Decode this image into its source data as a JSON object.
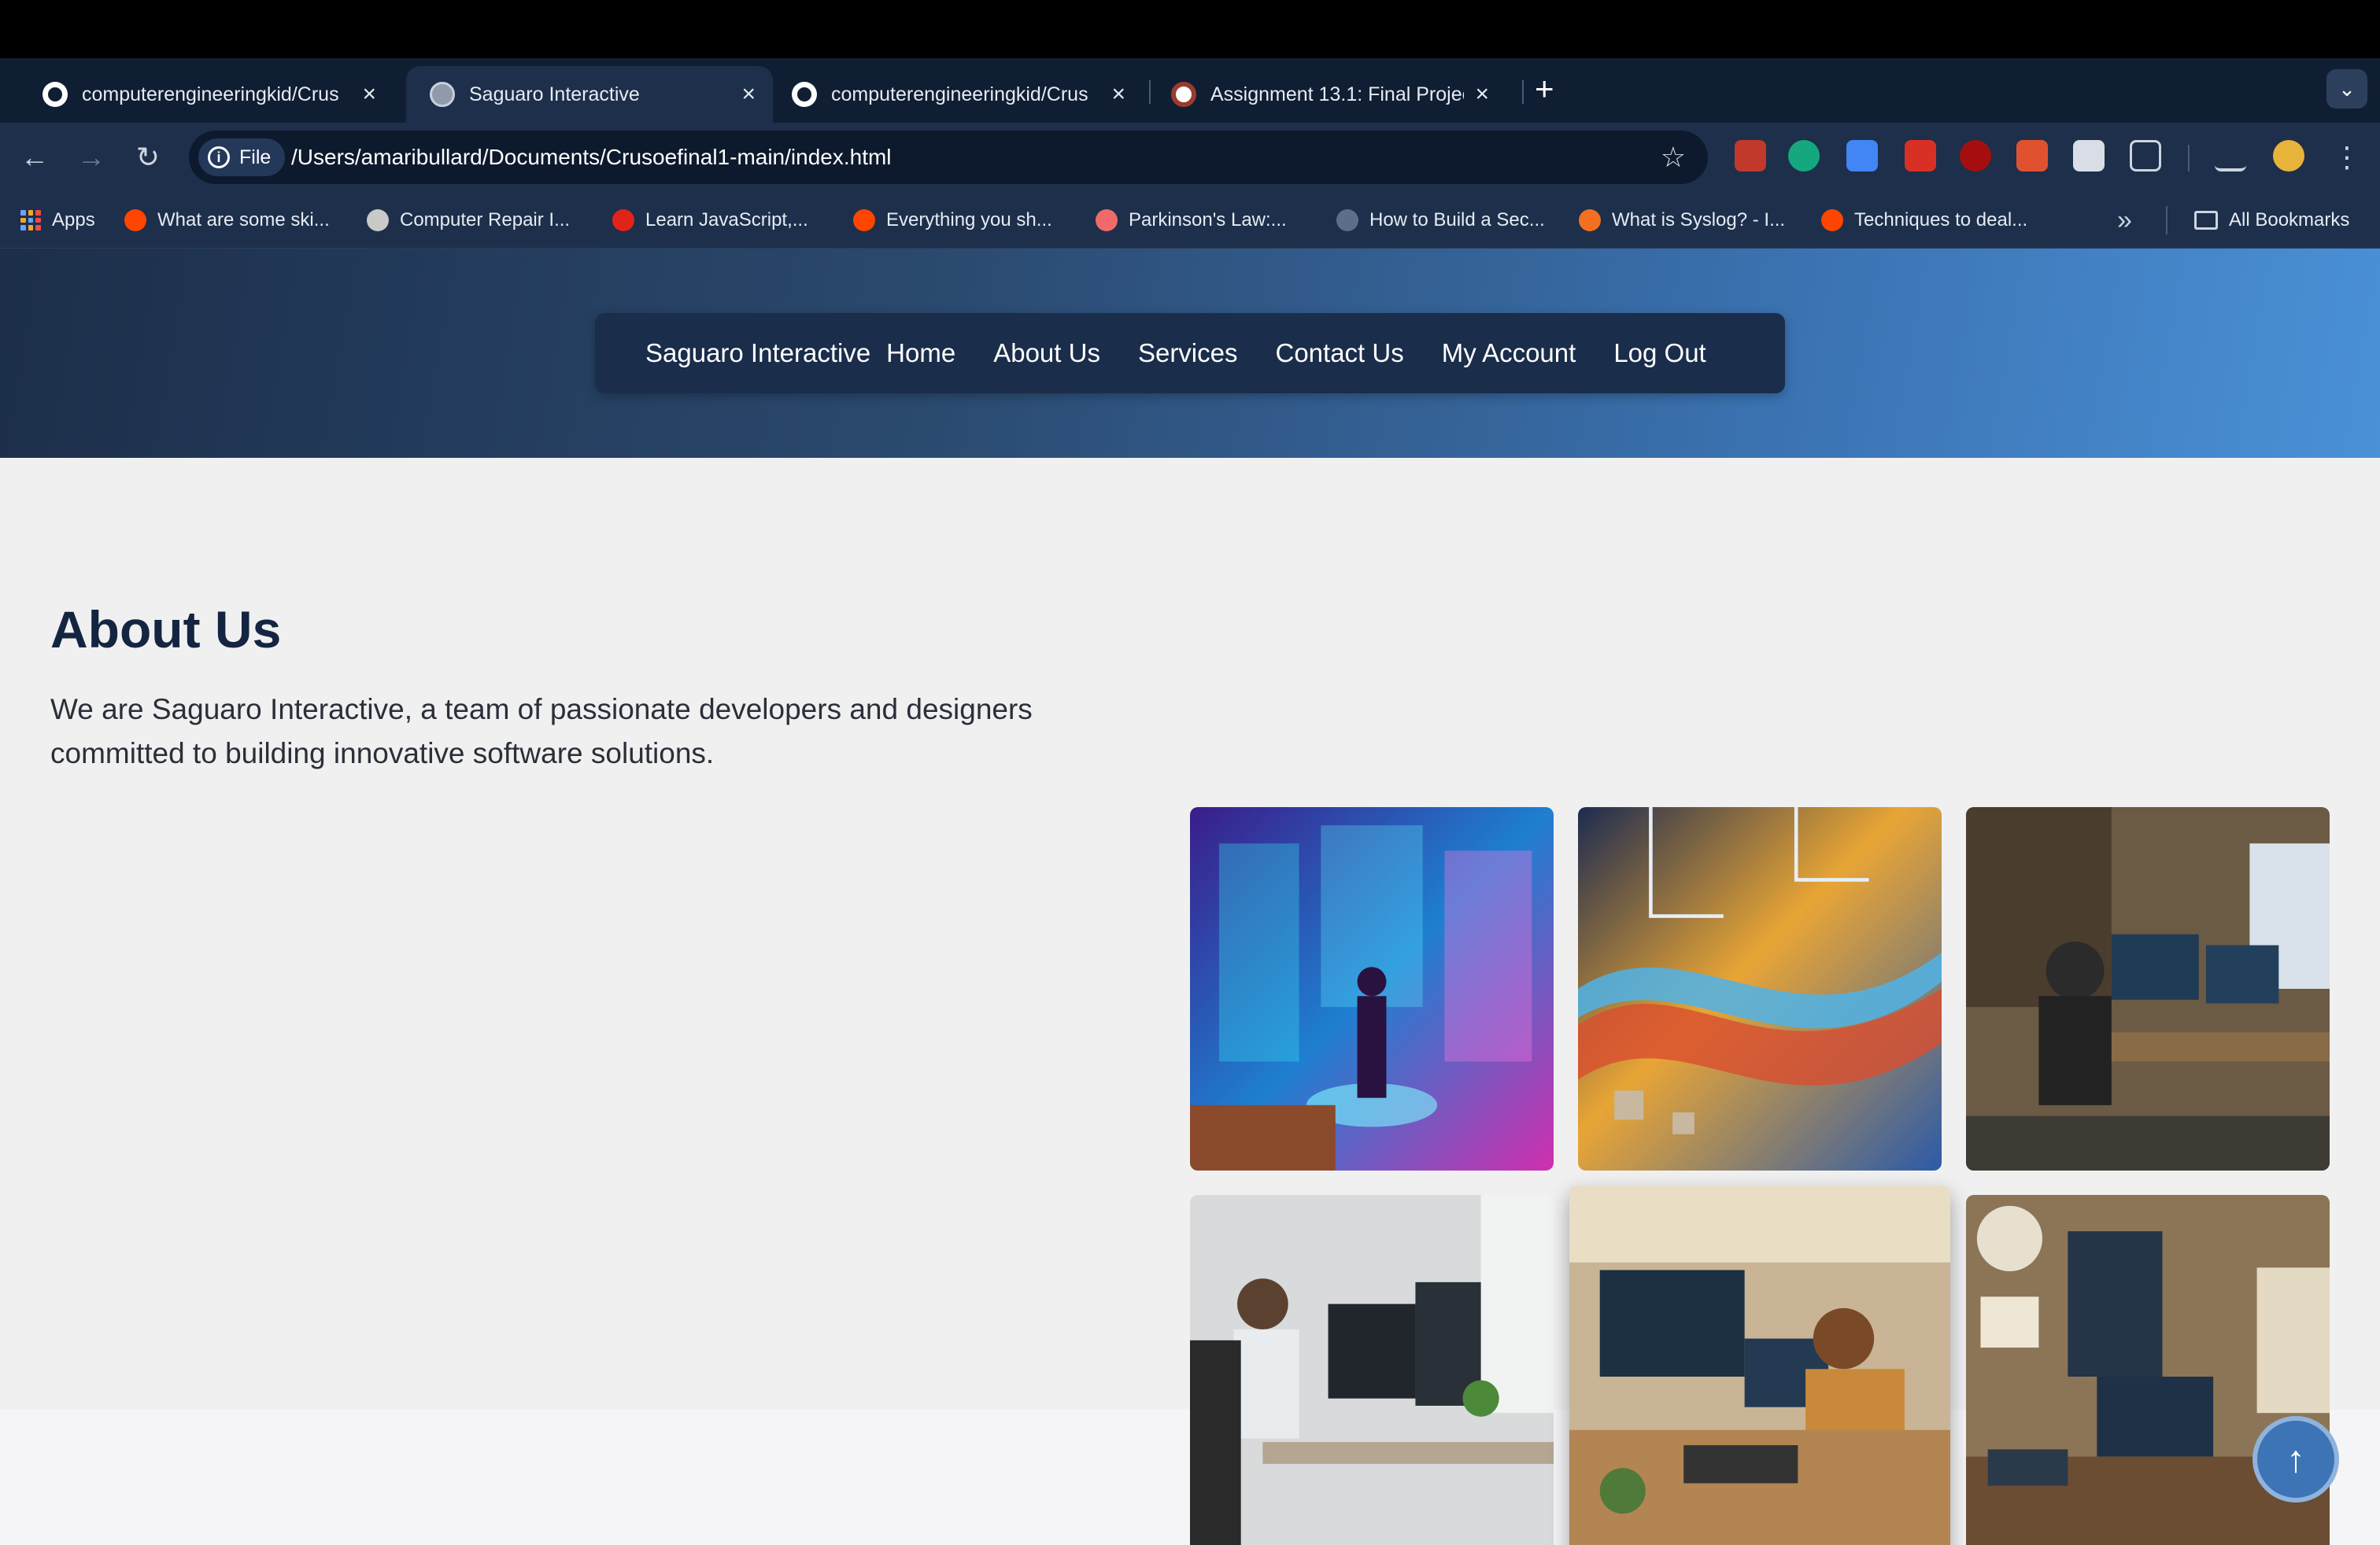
{
  "browser": {
    "tabs": [
      {
        "title": "computerengineeringkid/Crus",
        "icon": "github-icon",
        "active": false
      },
      {
        "title": "Saguaro Interactive",
        "icon": "globe-icon",
        "active": true
      },
      {
        "title": "computerengineeringkid/Crus",
        "icon": "github-icon",
        "active": false
      },
      {
        "title": "Assignment 13.1: Final Project",
        "icon": "assignment-icon",
        "active": false
      }
    ],
    "new_tab": "+",
    "tab_search": "⌄",
    "address": {
      "chip": "File",
      "url": "/Users/amaribullard/Documents/Crusoefinal1-main/index.html"
    },
    "bookmarks": [
      {
        "label": "Apps"
      },
      {
        "label": "What are some ski..."
      },
      {
        "label": "Computer Repair I..."
      },
      {
        "label": "Learn JavaScript,..."
      },
      {
        "label": "Everything you sh..."
      },
      {
        "label": "Parkinson's Law:..."
      },
      {
        "label": "How to Build a Sec..."
      },
      {
        "label": "What is Syslog? - I..."
      },
      {
        "label": "Techniques to deal..."
      }
    ],
    "bookmarks_more": "»",
    "all_bookmarks": "All Bookmarks"
  },
  "site": {
    "brand": "Saguaro Interactive",
    "nav": [
      "Home",
      "About Us",
      "Services",
      "Contact Us",
      "My Account",
      "Log Out"
    ],
    "about": {
      "title": "About Us",
      "text": "We are Saguaro Interactive, a team of passionate developers and designers committed to building innovative software solutions."
    },
    "back_to_top": "↑"
  },
  "colors": {
    "nav_bg": "#1a2d4a",
    "heading": "#142541",
    "accent": "#3d74b6"
  }
}
